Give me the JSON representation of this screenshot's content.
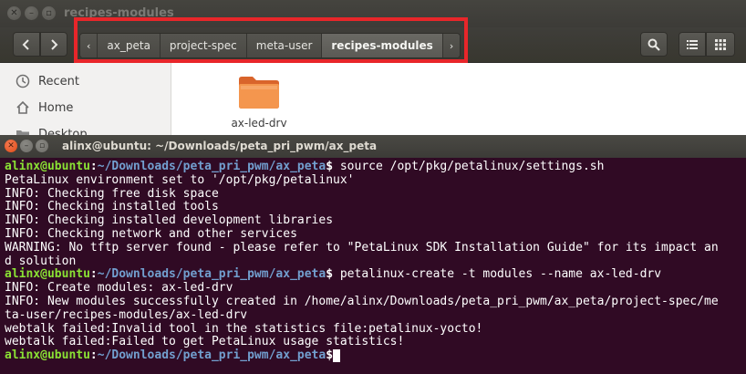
{
  "file_manager": {
    "title": "recipes-modules",
    "path": {
      "left_arrow": "‹",
      "crumbs": [
        "ax_peta",
        "project-spec",
        "meta-user",
        "recipes-modules"
      ],
      "right_arrow": "›"
    },
    "sidebar": {
      "items": [
        {
          "label": "Recent",
          "icon": "clock-icon"
        },
        {
          "label": "Home",
          "icon": "home-icon"
        },
        {
          "label": "Desktop",
          "icon": "folder-icon"
        }
      ]
    },
    "content": {
      "folder": {
        "label": "ax-led-drv",
        "icon": "folder-icon",
        "color": "#f08a3c"
      }
    }
  },
  "terminal": {
    "title": "alinx@ubuntu: ~/Downloads/peta_pri_pwm/ax_peta",
    "colors": {
      "background": "#300a24",
      "user": "#8ae234",
      "path": "#729fcf"
    },
    "lines": [
      {
        "kind": "prompt",
        "user": "alinx@ubuntu",
        "sep": ":",
        "path": "~/Downloads/peta_pri_pwm/ax_peta",
        "sym": "$",
        "cmd": " source /opt/pkg/petalinux/settings.sh"
      },
      {
        "kind": "text",
        "text": "PetaLinux environment set to '/opt/pkg/petalinux'"
      },
      {
        "kind": "text",
        "text": "INFO: Checking free disk space"
      },
      {
        "kind": "text",
        "text": "INFO: Checking installed tools"
      },
      {
        "kind": "text",
        "text": "INFO: Checking installed development libraries"
      },
      {
        "kind": "text",
        "text": "INFO: Checking network and other services"
      },
      {
        "kind": "text",
        "text": "WARNING: No tftp server found - please refer to \"PetaLinux SDK Installation Guide\" for its impact an"
      },
      {
        "kind": "text",
        "text": "d solution"
      },
      {
        "kind": "prompt",
        "user": "alinx@ubuntu",
        "sep": ":",
        "path": "~/Downloads/peta_pri_pwm/ax_peta",
        "sym": "$",
        "cmd": " petalinux-create -t modules --name ax-led-drv"
      },
      {
        "kind": "text",
        "text": "INFO: Create modules: ax-led-drv"
      },
      {
        "kind": "text",
        "text": "INFO: New modules successfully created in /home/alinx/Downloads/peta_pri_pwm/ax_peta/project-spec/me"
      },
      {
        "kind": "text",
        "text": "ta-user/recipes-modules/ax-led-drv"
      },
      {
        "kind": "text",
        "text": "webtalk failed:Invalid tool in the statistics file:petalinux-yocto!"
      },
      {
        "kind": "text",
        "text": "webtalk failed:Failed to get PetaLinux usage statistics!"
      },
      {
        "kind": "prompt",
        "user": "alinx@ubuntu",
        "sep": ":",
        "path": "~/Downloads/peta_pri_pwm/ax_peta",
        "sym": "$",
        "cmd": ""
      }
    ]
  }
}
